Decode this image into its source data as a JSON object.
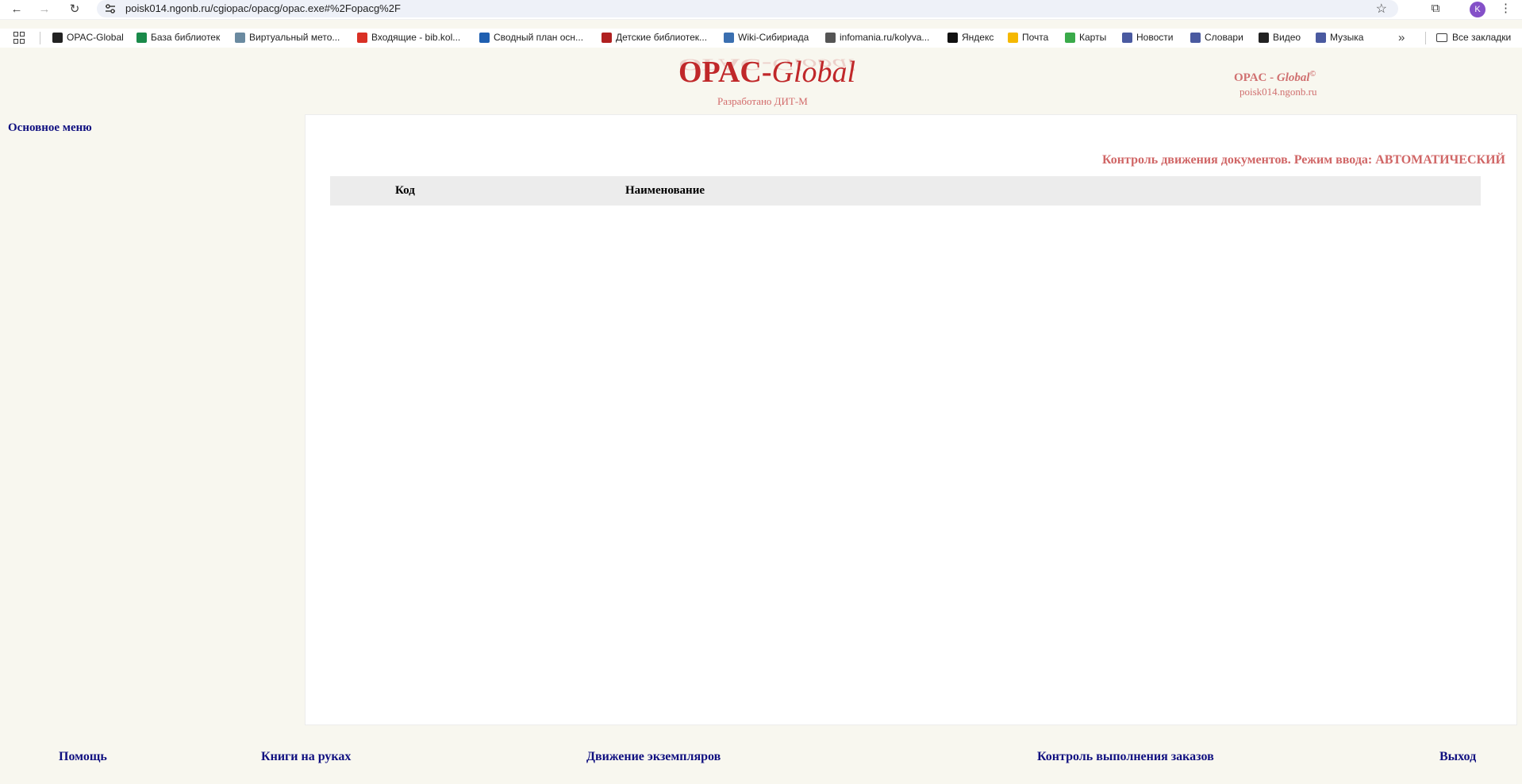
{
  "browser": {
    "url": "poisk014.ngonb.ru/cgiopac/opacg/opac.exe#%2Fopacg%2F",
    "profile_initial": "K",
    "bookmarks": [
      {
        "label": "OPAC-Global",
        "icon": "bookmark-icon",
        "color": "#222222"
      },
      {
        "label": "База библиотек",
        "icon": "map-pin-icon",
        "color": "#1a8a4a"
      },
      {
        "label": "Виртуальный мето...",
        "icon": "site-icon",
        "color": "#6a8aa0"
      },
      {
        "label": "Входящие - bib.kol...",
        "icon": "gmail-icon",
        "color": "#d93025"
      },
      {
        "label": "Сводный план осн...",
        "icon": "plan-icon",
        "color": "#1f5fb0"
      },
      {
        "label": "Детские библиотек...",
        "icon": "apple-icon",
        "color": "#b02020"
      },
      {
        "label": "Wiki-Сибириада",
        "icon": "wiki-icon",
        "color": "#3a6fb0"
      },
      {
        "label": "infomania.ru/kolyva...",
        "icon": "globe-icon",
        "color": "#555555"
      },
      {
        "label": "Яндекс",
        "icon": "yandex-icon",
        "color": "#111111"
      },
      {
        "label": "Почта",
        "icon": "mail-icon",
        "color": "#f5b800"
      },
      {
        "label": "Карты",
        "icon": "maps-icon",
        "color": "#3aaa4a"
      },
      {
        "label": "Новости",
        "icon": "news-icon",
        "color": "#4a5aa0"
      },
      {
        "label": "Словари",
        "icon": "dictionary-icon",
        "color": "#4a5aa0"
      },
      {
        "label": "Видео",
        "icon": "video-icon",
        "color": "#222222"
      },
      {
        "label": "Музыка",
        "icon": "music-icon",
        "color": "#4a5aa0"
      }
    ],
    "all_bookmarks_label": "Все закладки"
  },
  "header": {
    "logo_main": "OPAC-",
    "logo_italic": "Global",
    "developer": "Разработано ДИТ-М",
    "copyright_main": "OPAC - ",
    "copyright_italic": "Global",
    "copyright_symbol": "©",
    "host": "poisk014.ngonb.ru"
  },
  "sidebar": {
    "title": "Основное меню"
  },
  "main": {
    "title": "Контроль движения документов. Режим ввода: АВТОМАТИЧЕСКИЙ",
    "columns": [
      "Код",
      "Наименование"
    ]
  },
  "footer": {
    "links": [
      "Помощь",
      "Книги на руках",
      "Движение экземпляров",
      "Контроль выполнения заказов",
      "Выход"
    ]
  }
}
